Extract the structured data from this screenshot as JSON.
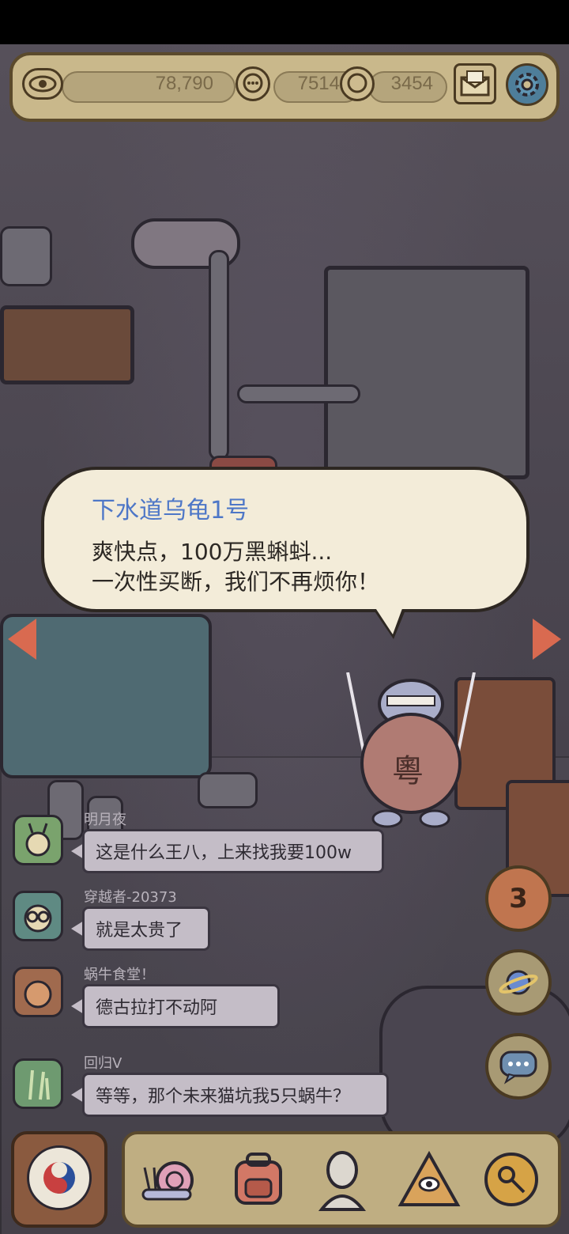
{
  "top_bar": {
    "eye_value": "78,790",
    "coin_value": "7514",
    "bubble_value": "3454",
    "icons": [
      "eye-icon",
      "speech-coin-icon",
      "chat-coin-icon",
      "mail-icon",
      "gear-icon"
    ]
  },
  "dialog": {
    "speaker": "下水道乌龟1号",
    "line1": "爽快点，100万黑蝌蚪...",
    "line2": "一次性买断，我们不再烦你！"
  },
  "character": {
    "badge_text": "粵"
  },
  "chat": [
    {
      "name": "明月夜",
      "message": "这是什么王八，上来找我要100w",
      "avatar_icon": "snail-avatar-icon"
    },
    {
      "name": "穿越者-20373",
      "message": "就是太贵了",
      "avatar_icon": "glasses-avatar-icon"
    },
    {
      "name": "蜗牛食堂！",
      "message": "德古拉打不动阿",
      "avatar_icon": "brown-avatar-icon"
    },
    {
      "name": "回归V",
      "message": "等等，那个未来猫坑我5只蜗牛？",
      "avatar_icon": "plant-avatar-icon"
    }
  ],
  "side_buttons": {
    "counter_value": "3"
  },
  "bottom_bar": {
    "tools": [
      "snail-icon",
      "backpack-icon",
      "statue-icon",
      "pyramid-eye-icon",
      "key-coin-icon"
    ]
  },
  "colors": {
    "bar_bg": "#c9b88b",
    "speaker_blue": "#4e77c7",
    "bubble_bg": "#f3ecd9",
    "nav_arrow": "#d96a50"
  }
}
